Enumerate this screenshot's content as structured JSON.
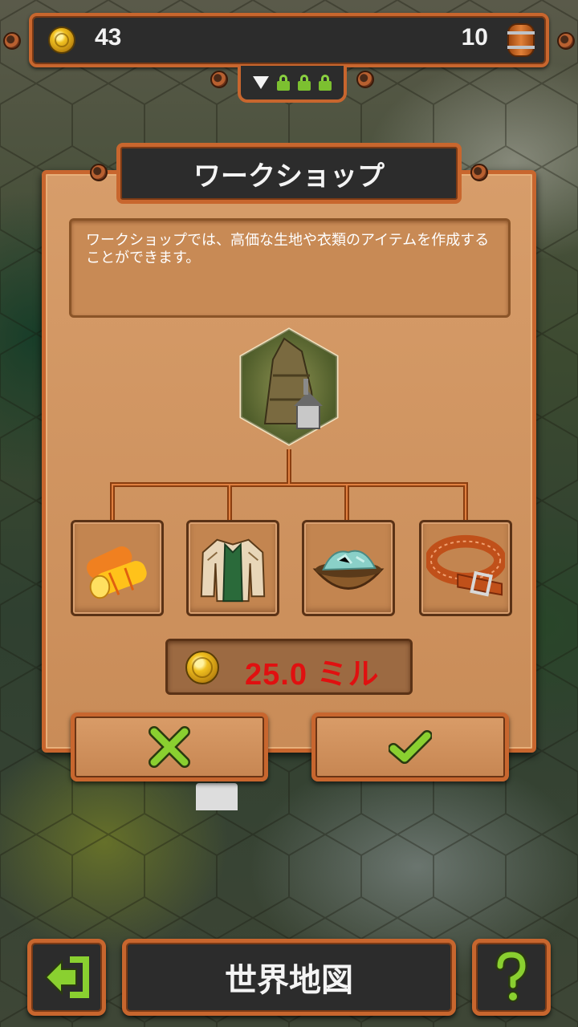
{
  "resources": {
    "coins": "43",
    "barrels": "10",
    "coin_icon": "gold-coin-icon",
    "barrel_icon": "barrel-icon",
    "locks": [
      "diamond-icon",
      "lock-icon",
      "lock-icon",
      "lock-icon"
    ]
  },
  "dialog": {
    "title": "ワークショップ",
    "description": "ワークショップでは、高価な生地や衣類のアイテムを作成することができます。",
    "building_icon": "workshop-building-icon",
    "products": [
      {
        "name": "fabric-rolls-icon"
      },
      {
        "name": "jacket-icon"
      },
      {
        "name": "dye-bowl-icon"
      },
      {
        "name": "leather-belt-icon"
      }
    ],
    "price": "25.0 ミル",
    "cancel_icon": "cross-icon",
    "confirm_icon": "check-icon"
  },
  "footer": {
    "exit_icon": "exit-arrow-icon",
    "title": "世界地図",
    "help_icon": "question-mark-icon"
  },
  "colors": {
    "frame": "#c8662e",
    "panel": "#d79d6a",
    "dark_plate": "#2c2c2c",
    "price_text": "#e01010",
    "accent_green": "#7cc030"
  }
}
